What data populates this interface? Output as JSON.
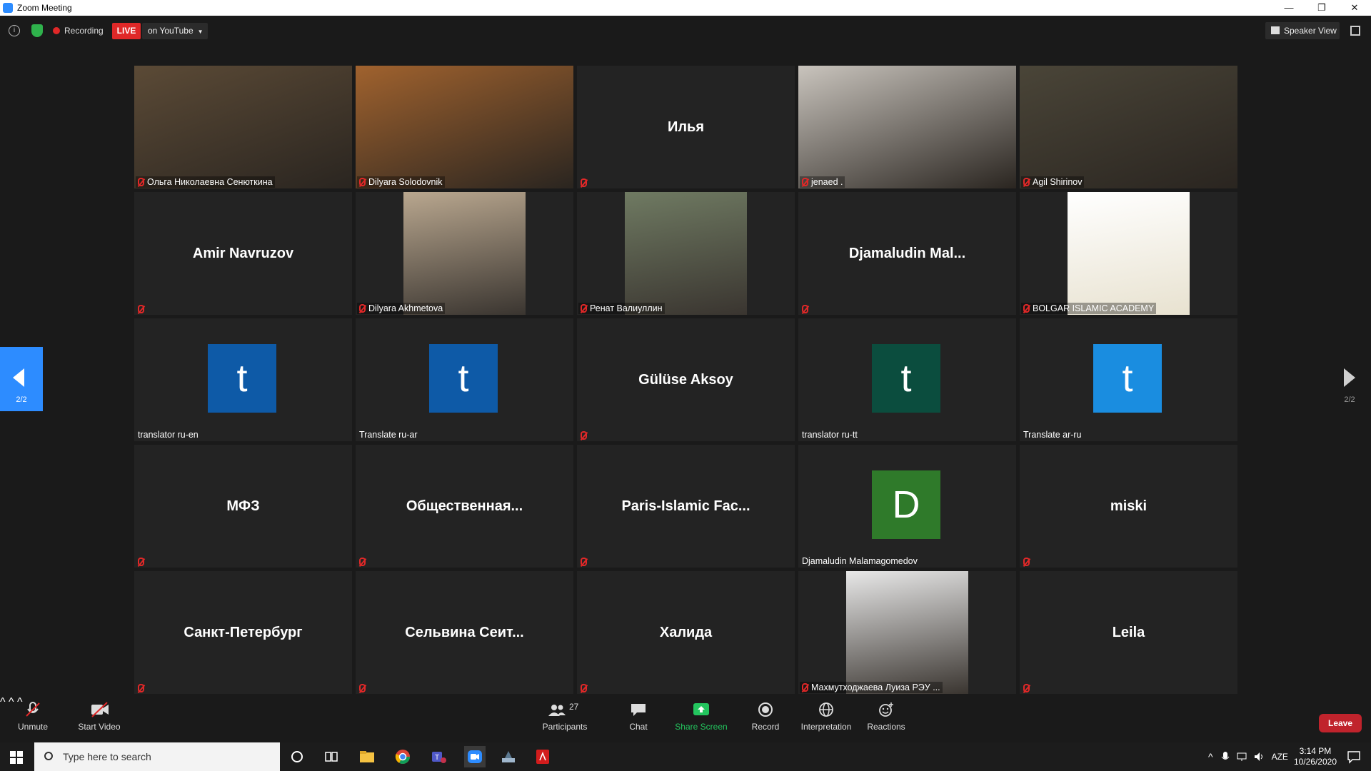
{
  "window": {
    "title": "Zoom Meeting",
    "controls": [
      "—",
      "❐",
      "✕"
    ]
  },
  "topbar": {
    "recording_label": "Recording",
    "live_label": "LIVE",
    "stream_label": "on YouTube",
    "speaker_view_label": "Speaker View"
  },
  "tiles": [
    {
      "type": "video",
      "name": "Ольга Николаевна Сенюткина",
      "muted": true,
      "bg": "#5b4a36"
    },
    {
      "type": "video",
      "name": "Dilyara Solodovnik",
      "muted": true,
      "bg": "#a0622e"
    },
    {
      "type": "name",
      "display": "Илья",
      "name": "",
      "muted": true
    },
    {
      "type": "video",
      "name": "jenaed .",
      "muted": true,
      "bg": "#c9c4bd"
    },
    {
      "type": "video",
      "name": "Agil Shirinov",
      "muted": true,
      "bg": "#4a4538"
    },
    {
      "type": "name",
      "display": "Amir Navruzov",
      "name": "",
      "muted": true
    },
    {
      "type": "photo",
      "name": "Dilyara Akhmetova",
      "muted": true,
      "bg": "#b9a78f"
    },
    {
      "type": "photo",
      "name": "Ренат Валиуллин",
      "muted": true,
      "bg": "#6f7a62"
    },
    {
      "type": "name",
      "display": "Djamaludin  Mal...",
      "name": "",
      "muted": true
    },
    {
      "type": "photo",
      "name": "BOLGAR ISLAMIC ACADEMY",
      "muted": true,
      "bg": "#ffffff"
    },
    {
      "type": "avatar",
      "letter": "t",
      "color": "#0e5aa7",
      "name": "translator ru-en",
      "muted": false
    },
    {
      "type": "avatar",
      "letter": "t",
      "color": "#0e5aa7",
      "name": "Translate ru-ar",
      "muted": false
    },
    {
      "type": "name",
      "display": "Gülüse Aksoy",
      "name": "",
      "muted": true
    },
    {
      "type": "avatar",
      "letter": "t",
      "color": "#0b4d3e",
      "name": "translator ru-tt",
      "muted": false
    },
    {
      "type": "avatar",
      "letter": "t",
      "color": "#1a8de0",
      "name": "Translate ar-ru",
      "muted": false
    },
    {
      "type": "name",
      "display": "МФЗ",
      "name": "",
      "muted": true
    },
    {
      "type": "name",
      "display": "Общественная...",
      "name": "",
      "muted": true
    },
    {
      "type": "name",
      "display": "Paris-Islamic  Fac...",
      "name": "",
      "muted": true
    },
    {
      "type": "avatar",
      "letter": "D",
      "color": "#2f7a2a",
      "name": "Djamaludin Malamagomedov",
      "muted": false
    },
    {
      "type": "name",
      "display": "miski",
      "name": "",
      "muted": true
    },
    {
      "type": "name",
      "display": "Санкт-Петербург",
      "name": "",
      "muted": true
    },
    {
      "type": "name",
      "display": "Сельвина  Сеит...",
      "name": "",
      "muted": true
    },
    {
      "type": "name",
      "display": "Халида",
      "name": "",
      "muted": true
    },
    {
      "type": "photo",
      "name": "Махмутходжаева Луиза РЭУ ...",
      "muted": true,
      "bg": "#e8e8e8"
    },
    {
      "type": "name",
      "display": "Leila",
      "name": "",
      "muted": true
    }
  ],
  "pager": {
    "left": "2/2",
    "right": "2/2"
  },
  "controls": {
    "unmute": "Unmute",
    "start_video": "Start Video",
    "participants": "Participants",
    "participants_count": "27",
    "chat": "Chat",
    "share_screen": "Share Screen",
    "record": "Record",
    "interpretation": "Interpretation",
    "reactions": "Reactions",
    "leave": "Leave"
  },
  "taskbar": {
    "search_placeholder": "Type here to search",
    "language": "AZE",
    "time": "3:14 PM",
    "date": "10/26/2020"
  },
  "colors": {
    "accent": "#2d8cff",
    "danger": "#e02828",
    "share": "#23c55e"
  }
}
